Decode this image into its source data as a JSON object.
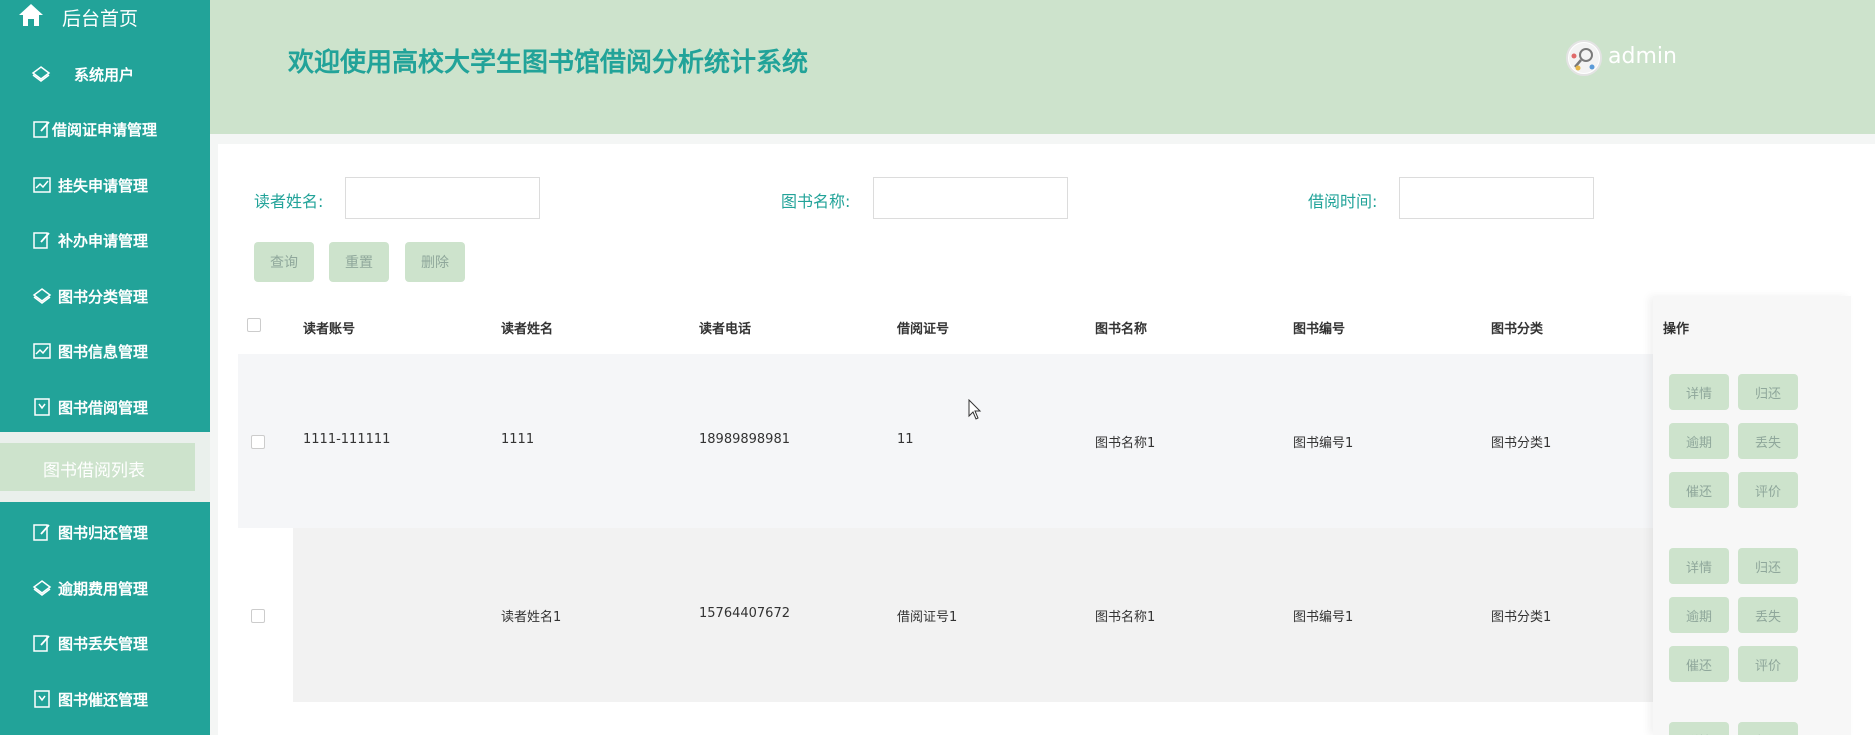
{
  "sidebar": {
    "home_label": "后台首页",
    "items": [
      {
        "label": "系统用户",
        "icon": "diamond-icon"
      },
      {
        "label": "借阅证申请管理",
        "icon": "edit-icon"
      },
      {
        "label": "挂失申请管理",
        "icon": "chart-icon"
      },
      {
        "label": "补办申请管理",
        "icon": "edit-icon"
      },
      {
        "label": "图书分类管理",
        "icon": "diamond-icon"
      },
      {
        "label": "图书信息管理",
        "icon": "chart-icon"
      },
      {
        "label": "图书借阅管理",
        "icon": "bookmark-icon"
      },
      {
        "label": "图书归还管理",
        "icon": "edit-icon"
      },
      {
        "label": "逾期费用管理",
        "icon": "diamond-icon"
      },
      {
        "label": "图书丢失管理",
        "icon": "edit-icon"
      },
      {
        "label": "图书催还管理",
        "icon": "bookmark-icon"
      }
    ],
    "active_sub": "图书借阅列表"
  },
  "header": {
    "title": "欢迎使用高校大学生图书馆借阅分析统计系统",
    "username": "admin"
  },
  "search": {
    "reader_name_label": "读者姓名:",
    "book_name_label": "图书名称:",
    "borrow_time_label": "借阅时间:",
    "reader_name_value": "",
    "book_name_value": "",
    "borrow_time_value": "",
    "query_label": "查询",
    "reset_label": "重置",
    "delete_label": "删除"
  },
  "table": {
    "columns": [
      "读者账号",
      "读者姓名",
      "读者电话",
      "借阅证号",
      "图书名称",
      "图书编号",
      "图书分类",
      "操作"
    ],
    "rows": [
      [
        "1111-111111",
        "1111",
        "18989898981",
        "11",
        "图书名称1",
        "图书编号1",
        "图书分类1"
      ],
      [
        "",
        "读者姓名1",
        "15764407672",
        "借阅证号1",
        "图书名称1",
        "图书编号1",
        "图书分类1"
      ]
    ],
    "actions": {
      "detail": "详情",
      "return": "归还",
      "overdue": "逾期",
      "lost": "丢失",
      "urge": "催还",
      "review": "评价"
    }
  },
  "colors": {
    "primary": "#22a399",
    "header_bg": "#cde3cc",
    "button_bg": "#cde3cc",
    "button_text": "#8fa79b"
  }
}
